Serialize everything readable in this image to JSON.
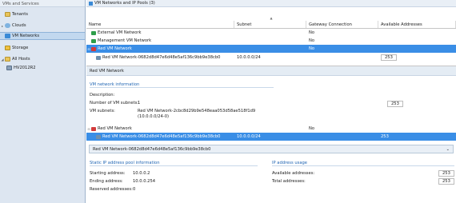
{
  "sidebar": {
    "header": "VMs and Services",
    "items": [
      {
        "label": "Tenants",
        "icon": "tenants-folder-icon",
        "arrow": ""
      },
      {
        "label": "Clouds",
        "icon": "cloud-icon",
        "arrow": "▸"
      },
      {
        "label": "VM Networks",
        "icon": "vm-network-icon",
        "arrow": ""
      },
      {
        "label": "Storage",
        "icon": "storage-icon",
        "arrow": ""
      },
      {
        "label": "All Hosts",
        "icon": "all-hosts-folder-icon",
        "arrow": "◢"
      },
      {
        "label": "HV2012R2",
        "icon": "host-icon",
        "arrow": ""
      }
    ]
  },
  "main": {
    "title": "VM Networks and IP Pools (3)",
    "columns": [
      "Name",
      "Subnet",
      "Gateway Connection",
      "Available Addresses"
    ],
    "rows": [
      {
        "name": "External VM Network",
        "subnet": "",
        "gateway": "No",
        "available": ""
      },
      {
        "name": "Management VM Network",
        "subnet": "",
        "gateway": "No",
        "available": ""
      },
      {
        "name": "Red VM Network",
        "subnet": "",
        "gateway": "No",
        "available": ""
      },
      {
        "name": "Red VM Network-0682d8d47e6d48e5af136c9bb9e38cb0",
        "subnet": "10.0.0.0/24",
        "gateway": "",
        "available": "253"
      }
    ]
  },
  "details": {
    "title": "Red VM Network",
    "info_title": "VM network information",
    "description_label": "Description:",
    "num_subnets_label": "Number of VM subnets:",
    "num_subnets_value": "1",
    "subnets_label": "VM subnets:",
    "subnets_value_1": "Red VM Network-2cbc8d29b9e548eaa053d58ae518f1d9",
    "subnets_value_2": "(10.0.0.0/24-0)",
    "available_value": "253",
    "sub_rows": [
      {
        "name": "Red VM Network",
        "subnet": "",
        "gateway": "No",
        "available": ""
      },
      {
        "name": "Red VM Network-0682d8d47e6d48e5af136c9bb9e38cb0",
        "subnet": "10.0.0.0/24",
        "gateway": "",
        "available": "253"
      }
    ],
    "combo_value": "Red VM Network-0682d8d47e6d48e5af136c9bb9e38cb0",
    "pool_title": "Static IP address pool information",
    "start_label": "Starting address:",
    "start_value": "10.0.0.2",
    "end_label": "Ending address:",
    "end_value": "10.0.0.254",
    "reserved_label": "Reserved addresses:",
    "reserved_value": "0",
    "usage_title": "IP address usage",
    "avail_label": "Available addresses:",
    "avail_value": "253",
    "total_label": "Total addresses:",
    "total_value": "253"
  }
}
